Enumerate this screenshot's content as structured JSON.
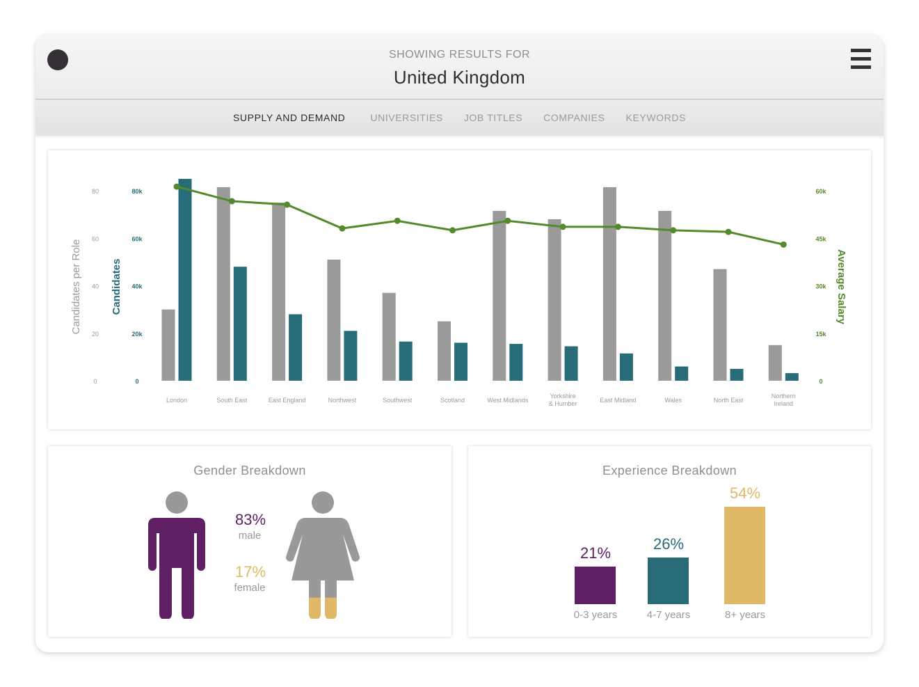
{
  "header": {
    "subtitle": "SHOWING RESULTS FOR",
    "title": "United Kingdom",
    "left_icon": "circle-icon",
    "menu_icon": "hamburger-menu-icon"
  },
  "tabs": [
    {
      "label": "SUPPLY AND DEMAND",
      "active": true
    },
    {
      "label": "UNIVERSITIES",
      "active": false
    },
    {
      "label": "JOB TITLES",
      "active": false
    },
    {
      "label": "COMPANIES",
      "active": false
    },
    {
      "label": "KEYWORDS",
      "active": false
    }
  ],
  "colors": {
    "gray_bar": "#9a9a9a",
    "teal": "#286b79",
    "green": "#548a2c",
    "purple": "#5f1f63",
    "gold": "#dfb968",
    "figure_gray": "#999999"
  },
  "chart_data": {
    "type": "bar",
    "categories": [
      "London",
      "South East",
      "East England",
      "Northwest",
      "Southwest",
      "Scotland",
      "West Midlands",
      "Yorkshire\n& Humber",
      "East Midland",
      "Wales",
      "North East",
      "Northern\nIreland"
    ],
    "series": [
      {
        "name": "Candidates per Role",
        "type": "bar",
        "axis": "left-outer",
        "values": [
          30,
          81.5,
          75,
          51,
          37,
          25,
          71.5,
          68,
          81.5,
          71.5,
          47,
          15
        ]
      },
      {
        "name": "Candidates",
        "type": "bar",
        "axis": "left-inner",
        "values": [
          85000,
          48000,
          28000,
          21000,
          16500,
          16000,
          15500,
          14500,
          11500,
          6000,
          5000,
          3200
        ]
      },
      {
        "name": "Average Salary",
        "type": "line",
        "axis": "right",
        "values": [
          61300,
          56700,
          55600,
          48100,
          50500,
          47500,
          50500,
          48600,
          48600,
          47500,
          47000,
          43000
        ]
      }
    ],
    "axes": {
      "left_outer": {
        "label": "Candidates per Role",
        "ticks": [
          "0",
          "20",
          "40",
          "60",
          "80"
        ],
        "range": [
          0,
          80
        ]
      },
      "left_inner": {
        "label": "Candidates",
        "ticks": [
          "0",
          "20k",
          "40k",
          "60k",
          "80k"
        ],
        "range": [
          0,
          80000
        ]
      },
      "right": {
        "label": "Average Salary",
        "ticks": [
          "0",
          "15k",
          "30k",
          "45k",
          "60k"
        ],
        "range": [
          0,
          60000
        ]
      }
    },
    "grid": false
  },
  "gender": {
    "title": "Gender Breakdown",
    "male_pct": "83%",
    "male_label": "male",
    "female_pct": "17%",
    "female_label": "female",
    "female_fill_fraction": 0.17
  },
  "experience": {
    "title": "Experience Breakdown",
    "bars": [
      {
        "label": "0-3 years",
        "pct": "21%",
        "value": 21
      },
      {
        "label": "4-7 years",
        "pct": "26%",
        "value": 26
      },
      {
        "label": "8+ years",
        "pct": "54%",
        "value": 54
      }
    ]
  }
}
